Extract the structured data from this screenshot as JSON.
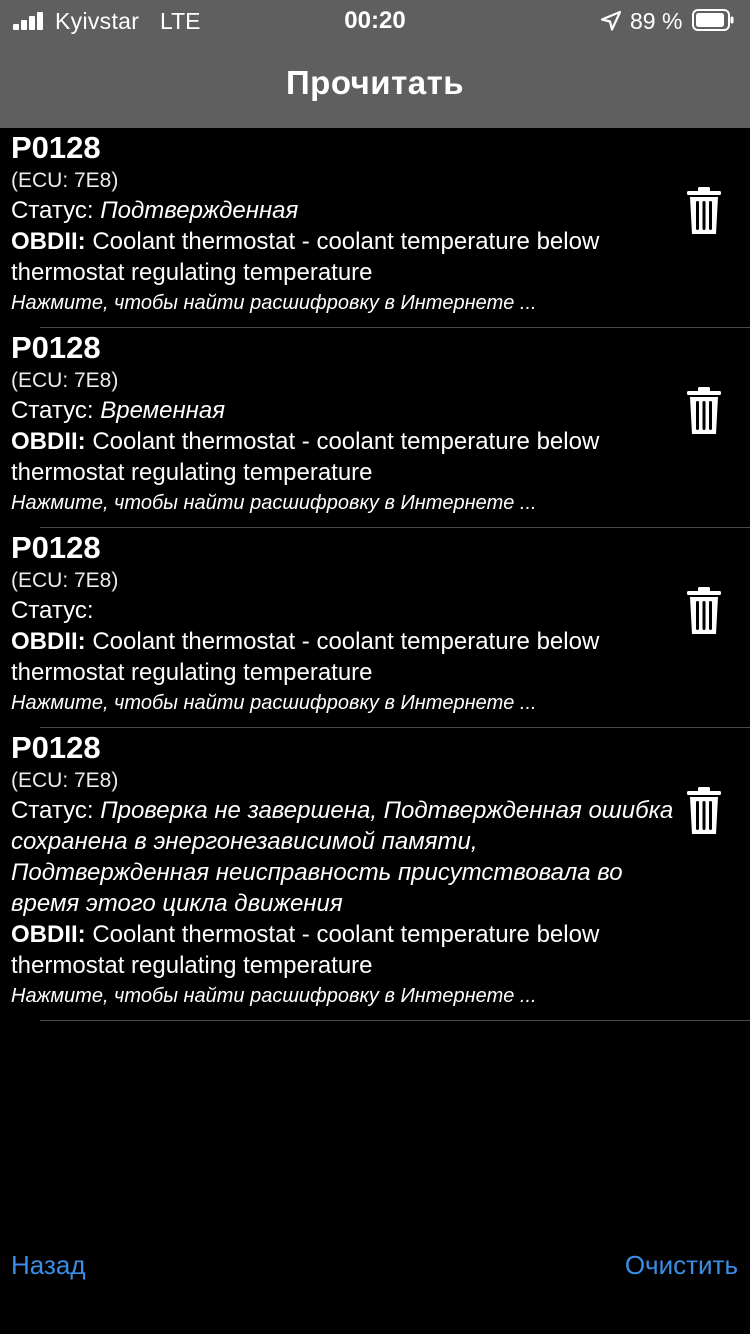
{
  "status_bar": {
    "carrier": "Kyivstar",
    "network": "LTE",
    "time": "00:20",
    "battery_percent": "89 %"
  },
  "nav": {
    "title": "Прочитать"
  },
  "codes": [
    {
      "code": "P0128",
      "ecu": "(ECU: 7E8)",
      "status_label": "Статус:",
      "status_value": "Подтвержденная",
      "obd_label": "OBDII:",
      "obd_text": "Coolant thermostat - coolant temperature below thermostat regulating temperature",
      "hint": "Нажмите, чтобы найти расшифровку в Интернете ..."
    },
    {
      "code": "P0128",
      "ecu": "(ECU: 7E8)",
      "status_label": "Статус:",
      "status_value": "Временная",
      "obd_label": "OBDII:",
      "obd_text": "Coolant thermostat - coolant temperature below thermostat regulating temperature",
      "hint": "Нажмите, чтобы найти расшифровку в Интернете ..."
    },
    {
      "code": "P0128",
      "ecu": "(ECU: 7E8)",
      "status_label": "Статус:",
      "status_value": "",
      "obd_label": "OBDII:",
      "obd_text": "Coolant thermostat - coolant temperature below thermostat regulating temperature",
      "hint": "Нажмите, чтобы найти расшифровку в Интернете ..."
    },
    {
      "code": "P0128",
      "ecu": "(ECU: 7E8)",
      "status_label": "Статус:",
      "status_value": "Проверка не завершена, Подтвержденная ошибка сохранена в энергонезависимой памяти, Подтвержденная неисправность присутствовала во время этого цикла движения",
      "obd_label": "OBDII:",
      "obd_text": "Coolant thermostat - coolant temperature below thermostat regulating temperature",
      "hint": "Нажмите, чтобы найти расшифровку в Интернете ..."
    }
  ],
  "toolbar": {
    "back_label": "Назад",
    "clear_label": "Очистить"
  },
  "colors": {
    "nav_background": "#5f5f5f",
    "background": "#000000",
    "text": "#ffffff",
    "link": "#3a8ee6",
    "separator": "#4a4a4a"
  },
  "icons": {
    "delete": "trash-icon",
    "location": "location-arrow-icon",
    "battery": "battery-icon",
    "signal": "signal-bars-icon"
  }
}
